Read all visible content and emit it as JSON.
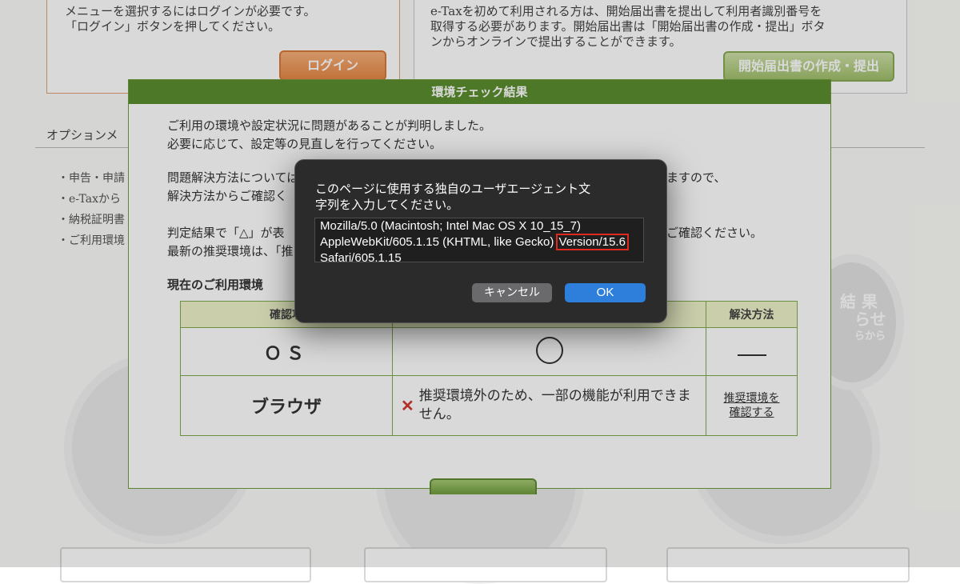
{
  "background_page": {
    "login_panel": {
      "text_line1": "メニューを選択するにはログインが必要です。",
      "text_line2": "「ログイン」ボタンを押してください。",
      "button": "ログイン"
    },
    "start_panel": {
      "text_line1": "e-Taxを初めて利用される方は、開始届出書を提出して利用者識別番号を",
      "text_line2": "取得する必要があります。開始届出書は「開始届出書の作成・提出」ボタ",
      "text_line3": "ンからオンラインで提出することができます。",
      "button": "開始届出書の作成・提出"
    },
    "option_menu": {
      "title": "オプションメ",
      "items": [
        "・申告・申請",
        "・e-Taxから",
        "・納税証明書",
        "・ご利用環境"
      ]
    },
    "right_circle_text": [
      "結 果",
      "らせ",
      "らから"
    ]
  },
  "env_modal": {
    "title": "環境チェック結果",
    "para1_line1": "ご利用の環境や設定状況に問題があることが判明しました。",
    "para1_line2": "必要に応じて、設定等の見直しを行ってください。",
    "para2_line1": "問題解決方法については",
    "para2_line1_end": "ますので、",
    "para2_line2": "解決方法からご確認く",
    "para3_line1": "判定結果で「△」が表",
    "para3_line1_end": "ご確認ください。",
    "para3_line2": "最新の推奨環境は、「推",
    "section_title": "現在のご利用環境",
    "table": {
      "headers": [
        "確認項",
        "",
        "解決方法"
      ],
      "rows": [
        {
          "item": "ＯＳ",
          "result_symbol": "circle",
          "solution": "—"
        },
        {
          "item": "ブラウザ",
          "result_text": "推奨環境外のため、一部の機能が利用できません。",
          "solution_line1": "推奨環境を",
          "solution_line2": "確認する"
        }
      ]
    }
  },
  "dialog": {
    "message_line1": "このページに使用する独自のユーザエージェント文",
    "message_line2": "字列を入力してください。",
    "input_line1": "Mozilla/5.0 (Macintosh; Intel Mac OS X 10_15_7)",
    "input_line2_a": "AppleWebKit/605.1.15 (KHTML, like Gecko)",
    "input_line2_highlight": "Version/15.6",
    "input_line3": "Safari/605.1.15",
    "cancel_label": "キャンセル",
    "ok_label": "OK",
    "highlight_color": "#e0291f"
  }
}
